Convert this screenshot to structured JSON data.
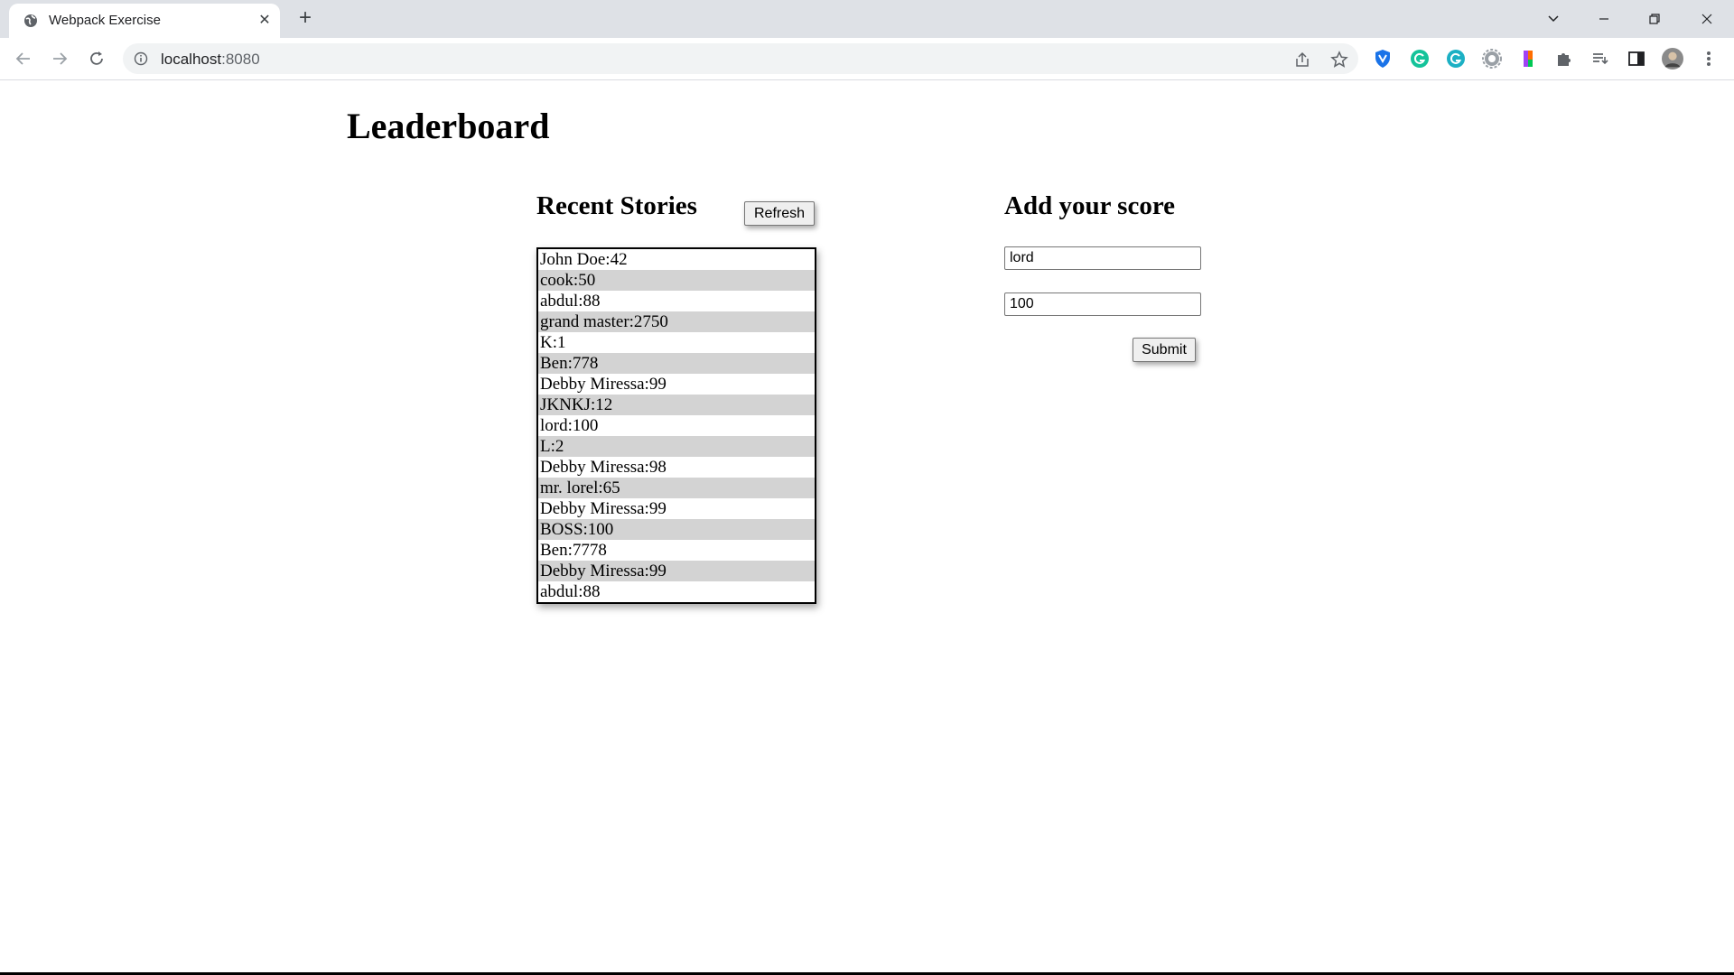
{
  "browser": {
    "tab_title": "Webpack Exercise",
    "tab_close_glyph": "✕",
    "new_tab_glyph": "+",
    "url_host": "localhost",
    "url_port": ":8080"
  },
  "page": {
    "heading": "Leaderboard",
    "recent": {
      "title": "Recent Stories",
      "refresh_label": "Refresh",
      "scores": [
        "John Doe:42",
        "cook:50",
        "abdul:88",
        "grand master:2750",
        "K:1",
        "Ben:778",
        "Debby Miressa:99",
        "JKNKJ:12",
        "lord:100",
        "L:2",
        "Debby Miressa:98",
        "mr. lorel:65",
        "Debby Miressa:99",
        "BOSS:100",
        "Ben:7778",
        "Debby Miressa:99",
        "abdul:88"
      ]
    },
    "form": {
      "title": "Add your score",
      "name_value": "lord",
      "score_value": "100",
      "submit_label": "Submit"
    }
  },
  "colors": {
    "tabstrip": "#dee1e6",
    "stripe": "#d3d3d3",
    "grammarly": "#15c39a",
    "shield": "#1a73e8"
  }
}
